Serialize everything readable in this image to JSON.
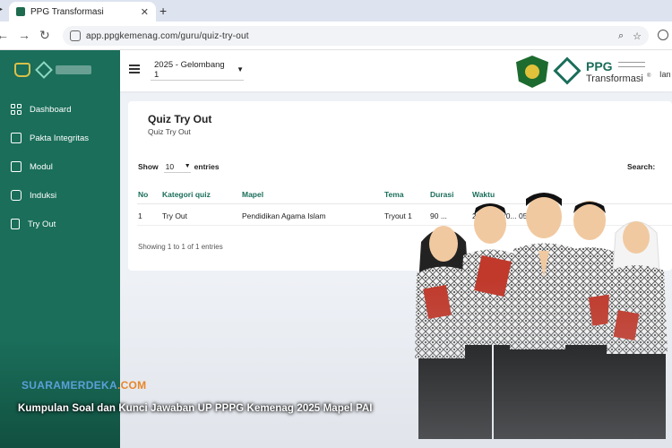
{
  "browser": {
    "tab_title": "PPG Transformasi",
    "tab_close": "✕",
    "new_tab": "+",
    "url": "app.ppgkemenag.com/guru/quiz-try-out"
  },
  "sidebar": {
    "items": [
      {
        "label": "Dashboard",
        "icon": "grid-icon"
      },
      {
        "label": "Pakta Integritas",
        "icon": "document-icon"
      },
      {
        "label": "Modul",
        "icon": "book-icon"
      },
      {
        "label": "Induksi",
        "icon": "play-icon"
      },
      {
        "label": "Try Out",
        "icon": "clipboard-icon"
      }
    ]
  },
  "header": {
    "batch_selected": "2025 - Gelombang 1",
    "brand_title": "PPG",
    "brand_subtitle": "Transformasi",
    "brand_reg": "®",
    "user_partial": "Ian"
  },
  "quiz": {
    "title": "Quiz Try Out",
    "subtitle": "Quiz Try Out",
    "show_label": "Show",
    "entries_value": "10",
    "entries_label": "entries",
    "search_label": "Search:",
    "columns": [
      "No",
      "Kategori quiz",
      "Mapel",
      "Tema",
      "Durasi",
      "Waktu"
    ],
    "rows": [
      {
        "no": "1",
        "kategori": "Try Out",
        "mapel": "Pendidikan Agama Islam",
        "tema": "Tryout 1",
        "durasi": "90 ...",
        "waktu": "2... 05 13:0... 05 ... 59:00"
      }
    ],
    "info": "Showing 1 to 1 of 1 entries"
  },
  "overlay": {
    "watermark_main": "SUARAMERDEKA",
    "watermark_suffix": ".COM",
    "caption": "Kumpulan Soal dan Kunci Jawaban UP PPPG Kemenag 2025 Mapel PAI"
  },
  "colors": {
    "sidebar": "#1a6e5a",
    "accent": "#1a6e5a",
    "background": "#eef1f6"
  }
}
